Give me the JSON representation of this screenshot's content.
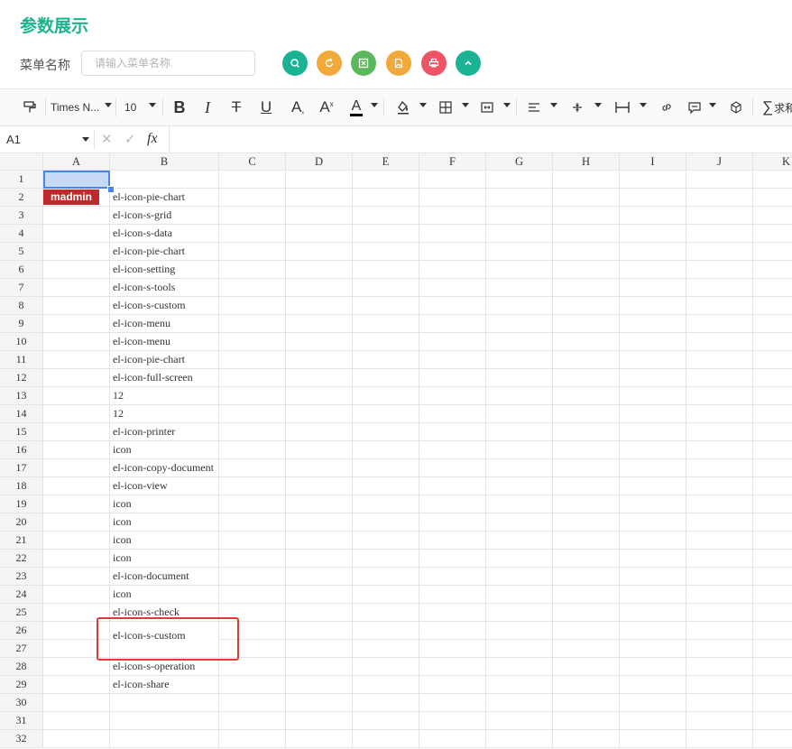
{
  "page": {
    "title": "参数展示"
  },
  "filter": {
    "label": "菜单名称",
    "placeholder": "请输入菜单名称"
  },
  "buttons": [
    {
      "name": "search-button",
      "color": "#1ab394",
      "icon": "search-icon"
    },
    {
      "name": "reset-button",
      "color": "#f0a93a",
      "icon": "refresh-icon"
    },
    {
      "name": "export-excel-button",
      "color": "#5cb85c",
      "icon": "excel-icon"
    },
    {
      "name": "export-image-button",
      "color": "#f0a93a",
      "icon": "image-icon"
    },
    {
      "name": "print-button",
      "color": "#ed5565",
      "icon": "printer-icon"
    },
    {
      "name": "collapse-button",
      "color": "#1ab394",
      "icon": "chevron-up-icon"
    }
  ],
  "toolbar": {
    "font_family": "Times N...",
    "font_size": "10",
    "sum_label": "求和"
  },
  "formula": {
    "cell_ref": "A1",
    "fx": "fx"
  },
  "sheet": {
    "columns": [
      "A",
      "B",
      "C",
      "D",
      "E",
      "F",
      "G",
      "H",
      "I",
      "J",
      "K"
    ],
    "rows": [
      "1",
      "2",
      "3",
      "4",
      "5",
      "6",
      "7",
      "8",
      "9",
      "10",
      "11",
      "12",
      "13",
      "14",
      "15",
      "16",
      "17",
      "18",
      "19",
      "20",
      "21",
      "22",
      "23",
      "24",
      "25",
      "26",
      "27",
      "28",
      "29",
      "30",
      "31",
      "32"
    ],
    "a2_tag": "madmin",
    "b_values": [
      "",
      "el-icon-pie-chart",
      "el-icon-s-grid",
      "el-icon-s-data",
      "el-icon-pie-chart",
      "el-icon-setting",
      "el-icon-s-tools",
      "el-icon-s-custom",
      "el-icon-menu",
      "el-icon-menu",
      "el-icon-pie-chart",
      "el-icon-full-screen",
      "12",
      "12",
      "el-icon-printer",
      "icon",
      "el-icon-copy-document",
      "el-icon-view",
      "icon",
      "icon",
      "icon",
      "icon",
      "el-icon-document",
      "icon",
      "el-icon-s-check",
      "el-icon-s-custom",
      "",
      "el-icon-s-operation",
      "el-icon-share",
      "",
      "",
      ""
    ],
    "highlight_color": "#e53935",
    "tag_color": "#c0282d",
    "selection_color": "#c7daf5"
  }
}
